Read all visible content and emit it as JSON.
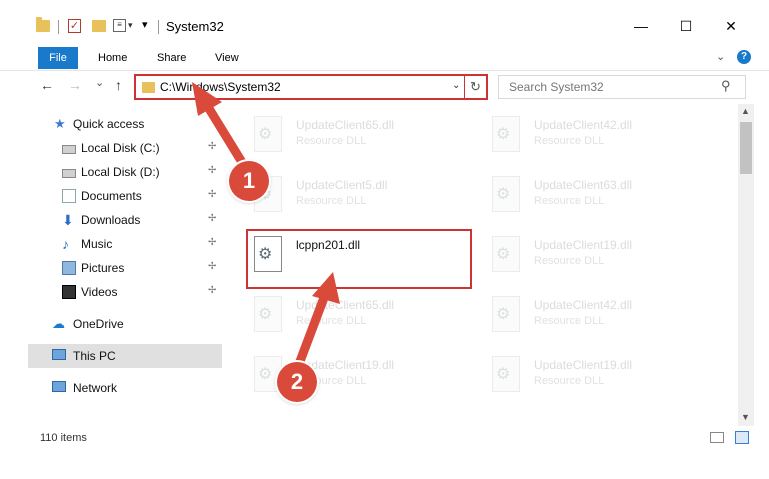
{
  "window": {
    "title": "System32",
    "minimize": "—",
    "maximize": "☐",
    "close": "✕"
  },
  "quick_access_toolbar": {
    "check_glyph": "✓",
    "props_glyph": "≡",
    "dropdown_glyph": "▾",
    "customize_glyph": "▾"
  },
  "ribbon": {
    "tabs": [
      "File",
      "Home",
      "Share",
      "View"
    ],
    "expand_glyph": "⌄",
    "help_glyph": "?"
  },
  "nav": {
    "back": "←",
    "forward": "→",
    "recent": "⌄",
    "up": "↑",
    "address": "C:\\Windows\\System32",
    "address_drop": "⌄",
    "refresh": "↻",
    "search_placeholder": "Search System32",
    "search_glyph": "⚲"
  },
  "sidebar": {
    "items": [
      {
        "label": "Quick access",
        "icon": "star-icon",
        "glyph": "★"
      },
      {
        "label": "Local Disk (C:)",
        "icon": "disk-icon",
        "pinned": true
      },
      {
        "label": "Local Disk (D:)",
        "icon": "disk-icon",
        "pinned": true
      },
      {
        "label": "Documents",
        "icon": "documents-icon",
        "pinned": true
      },
      {
        "label": "Downloads",
        "icon": "download-icon",
        "glyph": "⬇",
        "pinned": true
      },
      {
        "label": "Music",
        "icon": "music-icon",
        "glyph": "♪",
        "pinned": true
      },
      {
        "label": "Pictures",
        "icon": "pictures-icon",
        "pinned": true
      },
      {
        "label": "Videos",
        "icon": "videos-icon",
        "pinned": true
      },
      {
        "label": "OneDrive",
        "icon": "cloud-icon",
        "glyph": "☁"
      },
      {
        "label": "This PC",
        "icon": "computer-icon",
        "selected": true
      },
      {
        "label": "Network",
        "icon": "network-icon"
      }
    ],
    "pin_glyph": "📌"
  },
  "files": [
    {
      "name": "UpdateClient65.dll",
      "type": "Resource DLL"
    },
    {
      "name": "UpdateClient42.dll",
      "type": "Resource DLL"
    },
    {
      "name": "UpdateClient5.dll",
      "type": "Resource DLL"
    },
    {
      "name": "UpdateClient63.dll",
      "type": "Resource DLL"
    },
    {
      "name": "lcppn201.dll",
      "type": ""
    },
    {
      "name": "UpdateClient19.dll",
      "type": "Resource DLL"
    },
    {
      "name": "UpdateClient65.dll",
      "type": "Resource DLL"
    },
    {
      "name": "UpdateClient42.dll",
      "type": "Resource DLL"
    },
    {
      "name": "UpdateClient19.dll",
      "type": "Resource DLL"
    },
    {
      "name": "UpdateClient19.dll",
      "type": "Resource DLL"
    }
  ],
  "file_gear_glyph": "⚙",
  "scroll": {
    "up": "▲",
    "down": "▼"
  },
  "status": {
    "count": "110 items"
  },
  "annotations": {
    "badge1": "1",
    "badge2": "2",
    "color": "#d94a3a"
  }
}
